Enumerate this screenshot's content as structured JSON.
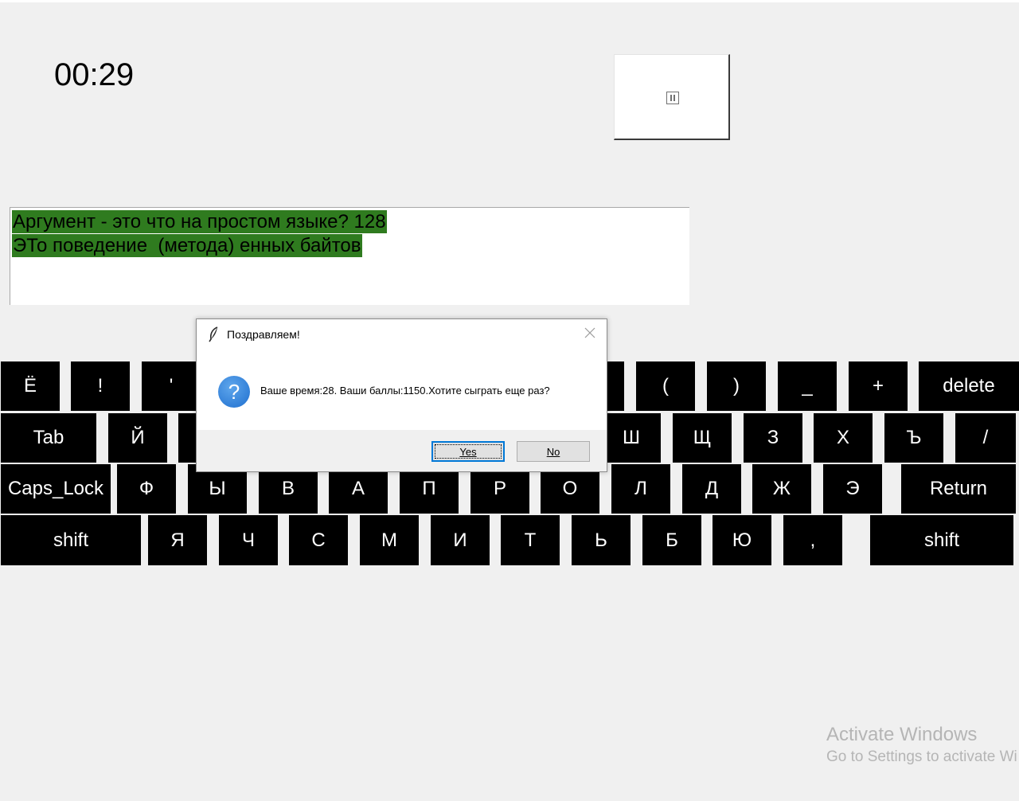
{
  "timer": {
    "value": "00:29"
  },
  "pause_button": {
    "icon": "pause-icon"
  },
  "typing_text": {
    "line1": "Аргумент - это что на простом языке? 128",
    "line2": "ЭТо поведение  (метода) енных байтов",
    "highlight_color": "#2f7b1f"
  },
  "keyboard": {
    "rows": [
      [
        "Ё",
        "!",
        "'",
        "",
        "",
        "",
        "",
        "",
        "",
        "(",
        ")",
        "_",
        "+",
        "delete"
      ],
      [
        "Tab",
        "Й",
        "",
        "",
        "",
        "",
        "",
        "",
        "",
        "Ш",
        "Щ",
        "З",
        "Х",
        "Ъ",
        "/"
      ],
      [
        "Caps_Lock",
        "Ф",
        "Ы",
        "В",
        "А",
        "П",
        "Р",
        "О",
        "Л",
        "Д",
        "Ж",
        "Э",
        "Return"
      ],
      [
        "shift",
        "Я",
        "Ч",
        "С",
        "М",
        "И",
        "Т",
        "Ь",
        "Б",
        "Ю",
        ",",
        "shift"
      ]
    ]
  },
  "dialog": {
    "title": "Поздравляем!",
    "message": "Ваше время:28. Ваши баллы:1150.Хотите сыграть еще раз?",
    "yes_label": "Yes",
    "no_label": "No",
    "icon": "question-icon"
  },
  "watermark": {
    "title": "Activate Windows",
    "subtitle": "Go to Settings to activate Wi"
  }
}
